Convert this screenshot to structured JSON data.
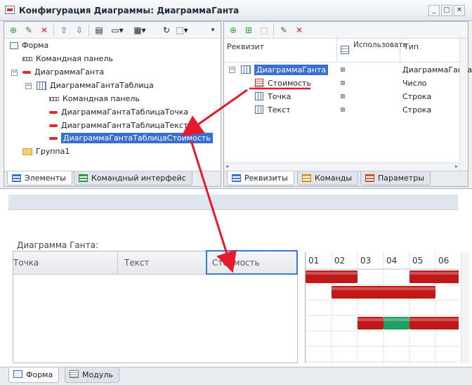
{
  "window": {
    "title": "Конфигурация Диаграммы: ДиаграммаГанта"
  },
  "left_tree": {
    "items": [
      {
        "label": "Форма",
        "icon": "form-icon"
      },
      {
        "label": "Командная панель",
        "icon": "command-panel-icon"
      },
      {
        "label": "ДиаграммаГанта",
        "icon": "gantt-element-icon"
      },
      {
        "label": "ДиаграммаГантаТаблица",
        "icon": "table-icon"
      },
      {
        "label": "Командная панель",
        "icon": "command-panel-icon"
      },
      {
        "label": "ДиаграммаГантаТаблицаТочка",
        "icon": "field-icon"
      },
      {
        "label": "ДиаграммаГантаТаблицаТекст",
        "icon": "field-icon"
      },
      {
        "label": "ДиаграммаГантаТаблицаСтоимость",
        "icon": "field-icon"
      },
      {
        "label": "Группа1",
        "icon": "folder-icon"
      }
    ],
    "selected_index": 7
  },
  "left_tabs": [
    {
      "label": "Элементы"
    },
    {
      "label": "Командный интерфейс"
    }
  ],
  "right_grid": {
    "headers": [
      "Реквизит",
      "Использовать",
      "Тип"
    ],
    "rows": [
      {
        "name": "ДиаграммаГанта",
        "type": "ДиаграммаГанта"
      },
      {
        "name": "Стоимость",
        "type": "Число"
      },
      {
        "name": "Точка",
        "type": "Строка"
      },
      {
        "name": "Текст",
        "type": "Строка"
      }
    ]
  },
  "right_tabs": [
    {
      "label": "Реквизиты"
    },
    {
      "label": "Команды"
    },
    {
      "label": "Параметры"
    }
  ],
  "preview": {
    "caption": "Диаграмма Ганта:",
    "columns": [
      "Точка",
      "Текст",
      "Стоимость"
    ],
    "timeline": [
      "01",
      "02",
      "03",
      "04",
      "05",
      "06"
    ],
    "bars": [
      {
        "row": 0,
        "start": 0,
        "end": 2,
        "color": "#c01818"
      },
      {
        "row": 0,
        "start": 4,
        "end": 6,
        "color": "#c01818"
      },
      {
        "row": 1,
        "start": 1,
        "end": 5,
        "color": "#c01818"
      },
      {
        "row": 3,
        "start": 2,
        "end": 3,
        "color": "#c01818"
      },
      {
        "row": 3,
        "start": 3,
        "end": 4,
        "color": "#1f9d62"
      },
      {
        "row": 3,
        "start": 4,
        "end": 6,
        "color": "#c01818"
      }
    ]
  },
  "bottom_tabs": [
    {
      "label": "Форма"
    },
    {
      "label": "Модуль"
    }
  ],
  "colors": {
    "accent_red": "#e8192c",
    "selection": "#3a6fd0"
  }
}
